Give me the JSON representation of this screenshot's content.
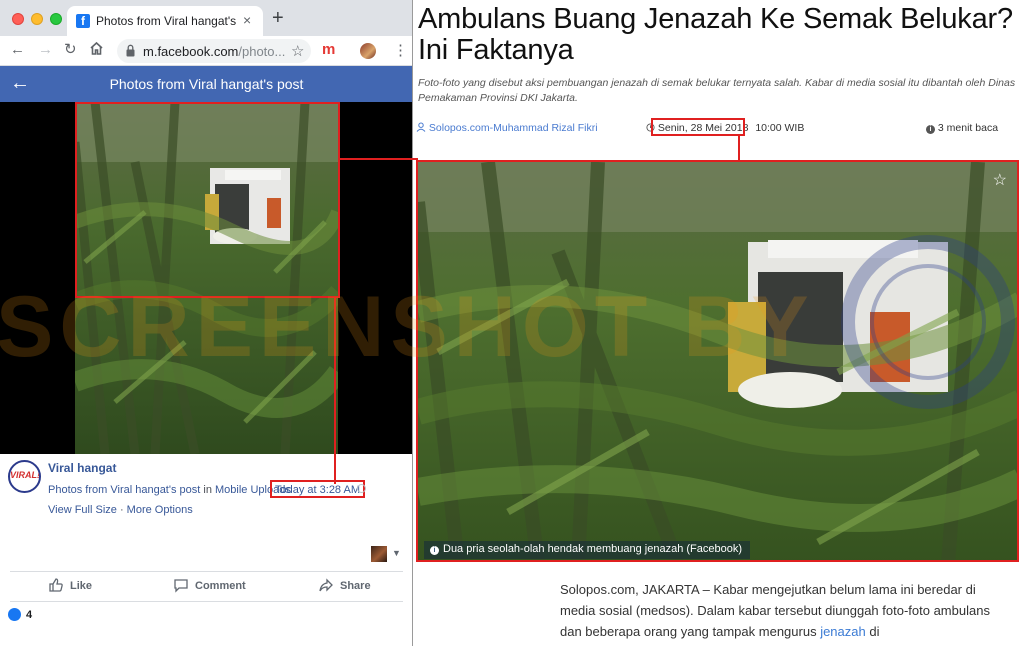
{
  "browser": {
    "tab_title": "Photos from Viral hangat's post",
    "tab_close": "×",
    "new_tab": "+",
    "url_host": "m.facebook.com",
    "url_path": "/photo...",
    "ext_label": "m",
    "fb_header": {
      "title": "Photos from Viral hangat's post"
    },
    "post": {
      "avatar_text": "VIRAL!",
      "page_name": "Viral hangat",
      "meta_prefix": "Photos from Viral hangat's post",
      "meta_in": " in ",
      "meta_album": "Mobile Uploads",
      "timestamp": "Today at 3:28 AM",
      "view_full_size": "View Full Size",
      "separator": " · ",
      "more_options": "More Options",
      "actions": {
        "like": "Like",
        "comment": "Comment",
        "share": "Share"
      },
      "like_count": "4"
    }
  },
  "watermark": "SCREENSHOT BY",
  "article": {
    "headline": "Ambulans Buang Jenazah Ke Semak Belukar? Ini Faktanya",
    "lede": "Foto-foto yang disebut aksi pembuangan jenazah di semak belukar ternyata salah. Kabar di media sosial itu dibantah oleh Dinas Pemakaman Provinsi DKI Jakarta.",
    "author": "Solopos.com-Muhammad Rizal Fikri",
    "date": "Senin, 28 Mei 2018",
    "time": "10:00 WIB",
    "read_time": "3 menit baca",
    "caption": "Dua pria seolah-olah hendak membuang jenazah (Facebook)",
    "caption_info": "i",
    "body_text": "Solopos.com, JAKARTA – Kabar mengejutkan belum lama ini beredar di media sosial (medsos). Dalam kabar tersebut diunggah foto-foto ambulans dan beberapa orang yang tampak mengurus ",
    "body_link": "jenazah",
    "body_tail": " di"
  }
}
